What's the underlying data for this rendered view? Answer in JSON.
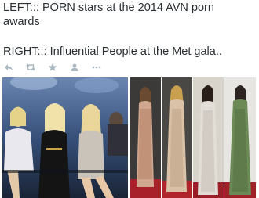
{
  "tweet": {
    "line1": "LEFT::: PORN stars at the 2014 AVN porn",
    "line2": "awards",
    "line3": "RIGHT::: Influential People at the Met gala.."
  },
  "actions": [
    {
      "name": "reply-icon"
    },
    {
      "name": "retweet-icon"
    },
    {
      "name": "favorite-icon"
    },
    {
      "name": "share-icon"
    },
    {
      "name": "more-icon"
    }
  ],
  "colors": {
    "text": "#292f33",
    "action_icon": "#aab8c2",
    "left_photo_bg": "#2a3a52",
    "right_photo_bg": "#2a2a2a"
  }
}
